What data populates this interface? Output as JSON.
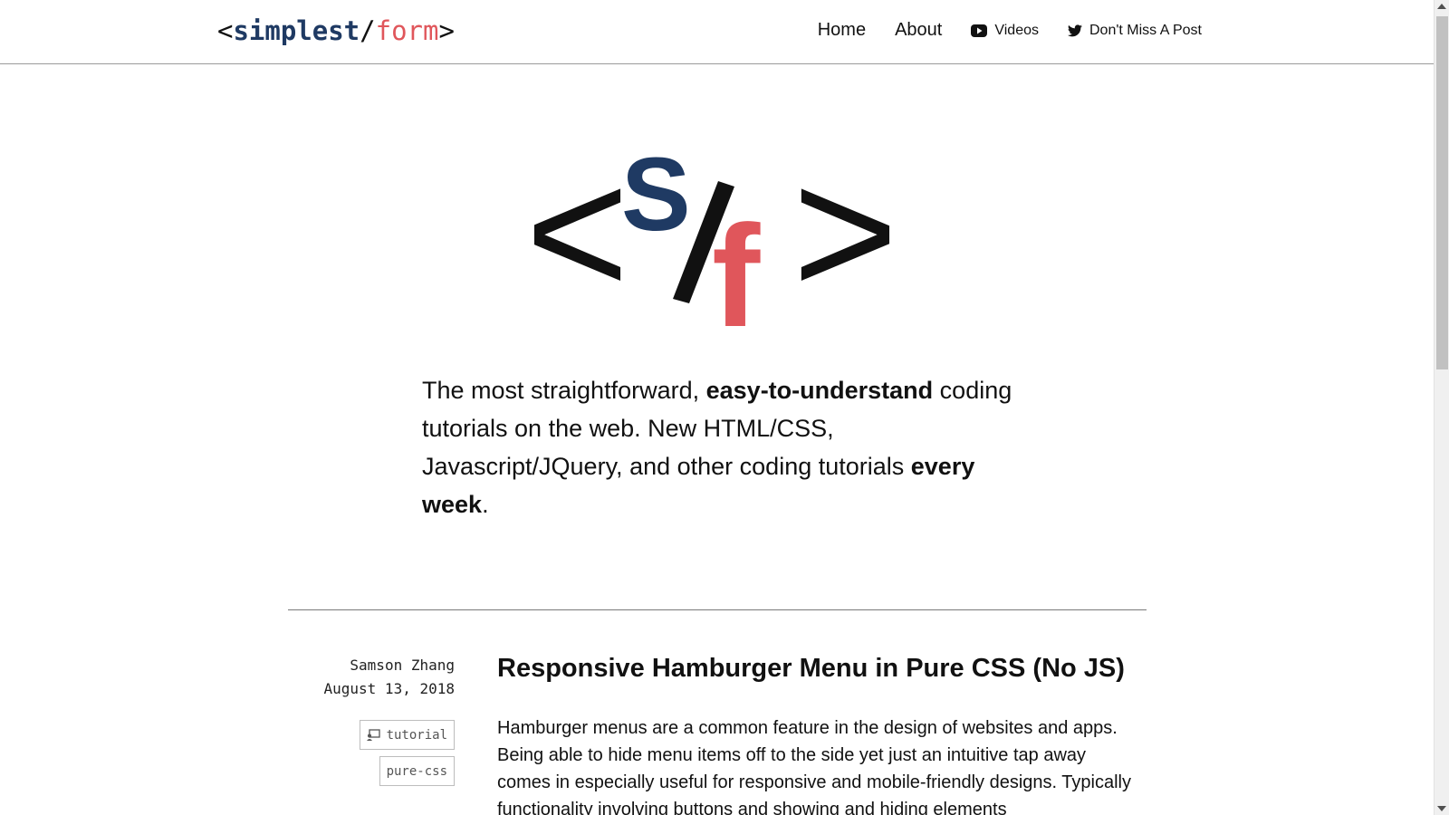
{
  "header": {
    "brand": {
      "open": "<",
      "s_part": "simplest",
      "slash": "/",
      "f_part": "form",
      "close": ">"
    },
    "nav": [
      {
        "label": "Home",
        "icon": null
      },
      {
        "label": "About",
        "icon": null
      },
      {
        "label": "Videos",
        "icon": "youtube-icon"
      },
      {
        "label": "Don't Miss A Post",
        "icon": "twitter-icon"
      }
    ]
  },
  "hero": {
    "logo": {
      "open": "<",
      "s": "S",
      "slash": "/",
      "f": "f",
      "close": ">"
    },
    "tagline": {
      "part1": "The most straightforward, ",
      "bold1": "easy-to-understand",
      "part2": " coding tutorials on the web. New HTML/CSS, Javascript/JQuery, and other coding tutorials ",
      "bold2": "every week",
      "part3": "."
    }
  },
  "post": {
    "author": "Samson Zhang",
    "date": "August 13, 2018",
    "tags": [
      {
        "label": "tutorial",
        "icon": "presentation-icon"
      },
      {
        "label": "pure-css",
        "icon": null
      }
    ],
    "title": "Responsive Hamburger Menu in Pure CSS (No JS)",
    "excerpt": "Hamburger menus are a common feature in the design of websites and apps. Being able to hide menu items off to the side yet just an intuitive tap away comes in especially useful for responsive and mobile-friendly designs. Typically functionality involving buttons and showing and hiding elements"
  },
  "colors": {
    "navy": "#1f3a63",
    "coral": "#e0565b",
    "text": "#111111",
    "divider": "#7a7a7a"
  }
}
